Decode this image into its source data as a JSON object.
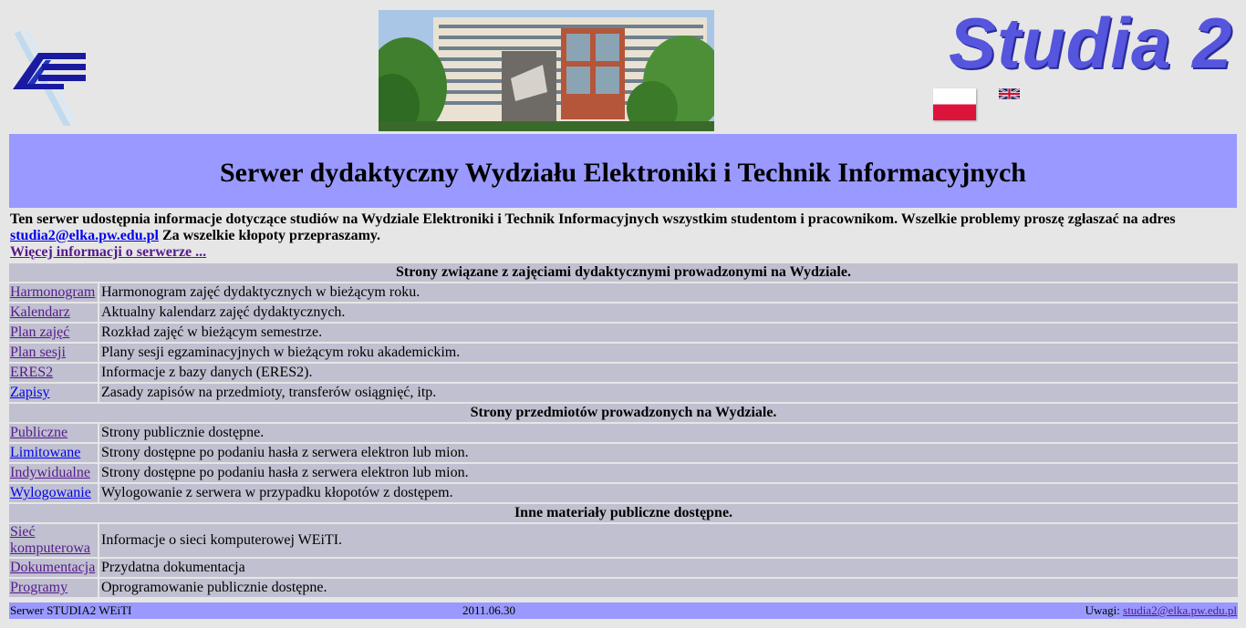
{
  "header": {
    "brand": "Studia 2",
    "logo_icon": "weiti-logo-icon",
    "photo_icon": "faculty-building-photo",
    "flags": [
      {
        "name": "polish-flag-icon",
        "colors": [
          "#ffffff",
          "#dc143c"
        ]
      },
      {
        "name": "british-flag-icon",
        "colors": [
          "#012169",
          "#ffffff",
          "#c8102e"
        ]
      }
    ]
  },
  "colors": {
    "background": "#e6e6e6",
    "title_bar": "#9999ff",
    "row": "#c0c0d0",
    "brand": "#5555dd",
    "link": "#551a8b",
    "link_unvisited": "#0000ee"
  },
  "title": "Serwer dydaktyczny Wydziału Elektroniki i Technik Informacyjnych",
  "intro": {
    "text1": "Ten serwer udostępnia informacje dotyczące studiów na Wydziale Elektroniki i Technik Informacyjnych wszystkim studentom i pracownikom. Wszelkie problemy proszę zgłaszać na adres",
    "email": "studia2@elka.pw.edu.pl",
    "text2": "Za wszelkie kłopoty przepraszamy.",
    "more_link": "Więcej informacji o serwerze ..."
  },
  "sections": [
    {
      "heading": "Strony związane z zajęciami dydaktycznymi prowadzonymi na Wydziale.",
      "rows": [
        {
          "link": "Harmonogram",
          "desc": "Harmonogram zajęć dydaktycznych w bieżącym roku."
        },
        {
          "link": "Kalendarz",
          "desc": "Aktualny kalendarz zajęć dydaktycznych."
        },
        {
          "link": "Plan zajęć",
          "desc": "Rozkład zajęć w bieżącym semestrze."
        },
        {
          "link": "Plan sesji",
          "desc": "Plany sesji egzaminacyjnych w bieżącym roku akademickim."
        },
        {
          "link": "ERES2",
          "desc": "Informacje z bazy danych (ERES2)."
        },
        {
          "link": "Zapisy",
          "desc": "Zasady zapisów na przedmioty, transferów osiągnięć, itp."
        }
      ]
    },
    {
      "heading": "Strony przedmiotów prowadzonych na Wydziale.",
      "rows": [
        {
          "link": "Publiczne",
          "desc": "Strony publicznie dostępne."
        },
        {
          "link": "Limitowane",
          "desc": "Strony dostępne po podaniu hasła z serwera elektron lub mion."
        },
        {
          "link": "Indywidualne",
          "desc": "Strony dostępne po podaniu hasła z serwera elektron lub mion."
        },
        {
          "link": "Wylogowanie",
          "desc": "Wylogowanie z serwera w przypadku kłopotów z dostępem."
        }
      ]
    },
    {
      "heading": "Inne materiały publiczne dostępne.",
      "rows": [
        {
          "link": "Sieć komputerowa",
          "desc": "Informacje o sieci komputerowej WEiTI."
        },
        {
          "link": "Dokumentacja",
          "desc": "Przydatna dokumentacja"
        },
        {
          "link": "Programy",
          "desc": "Oprogramowanie publicznie dostępne."
        }
      ]
    }
  ],
  "footer": {
    "left": "Serwer STUDIA2 WEiTI",
    "date": "2011.06.30",
    "remarks_label": "Uwagi:",
    "email": "studia2@elka.pw.edu.pl"
  }
}
